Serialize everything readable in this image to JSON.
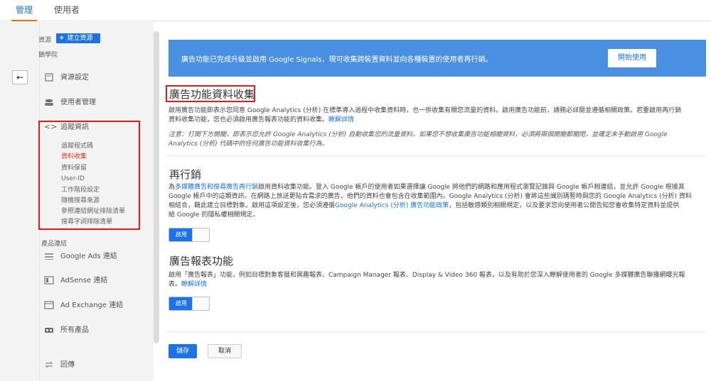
{
  "top_tabs": [
    {
      "label": "管理"
    },
    {
      "label": "使用者"
    }
  ],
  "sidebar": {
    "resource_label": "資源",
    "create_button": "建立資源",
    "plus_glyph": "+",
    "academy_label": "鵝學院",
    "items": [
      {
        "label": "資源設定",
        "icon": "document-icon"
      },
      {
        "label": "使用者管理",
        "icon": "users-icon"
      },
      {
        "label": "追蹤資訊",
        "icon": "code-icon"
      }
    ],
    "tracking_subitems": [
      {
        "label": "追蹤程式碼"
      },
      {
        "label": "資料收集",
        "active": true
      },
      {
        "label": "資料保留"
      },
      {
        "label": "User-ID"
      },
      {
        "label": "工作階段設定"
      },
      {
        "label": "隨機搜尋來源"
      },
      {
        "label": "參照連結網址排除清單"
      },
      {
        "label": "搜尋字詞排除清單"
      }
    ],
    "product_links_heading": "產品連結",
    "product_links": [
      {
        "label": "Google Ads 連結",
        "icon": "ads-icon"
      },
      {
        "label": "AdSense 連結",
        "icon": "adsense-icon"
      },
      {
        "label": "Ad Exchange 連結",
        "icon": "adexchange-icon"
      },
      {
        "label": "所有產品",
        "icon": "link-icon"
      }
    ],
    "postback_label": "回傳",
    "back_glyph": "←",
    "code_glyph": "<>"
  },
  "banner": {
    "text": "廣告功能已完成升級並啟用 Google Signals，現可收集跨裝置資料並向各種裝置的使用者再行銷。",
    "button": "開始使用"
  },
  "section_ad_features": {
    "title": "廣告功能資料收集",
    "para_1": "啟用廣告功能即表示您同意 Google Analytics (分析) 在標準導入過程中收集資料時，也一併收集有關您流量的資料。啟用廣告功能前，請務必詳閱並遵循相關政策。若要啟用再行銷",
    "para_2": "資料收集功能，您也必須啟用廣告報表功能的資料收集。",
    "learn_more": "瞭解詳情",
    "note_1": "注意：打開下方開關，即表示您允許 Google Analytics (分析) 自動收集您的流量資料。如果您不想收集廣告功能相關資料，必須將兩個開關都關閉，並確定未手動啟用 Google",
    "note_2": "Analytics (分析) 代碼中的任何廣告功能資料收集行為。"
  },
  "section_remarketing": {
    "title": "再行銷",
    "line_1_pre": "為",
    "line_1_link": "多媒體廣告和搜尋廣告再行銷",
    "line_1_post": "啟用資料收集功能。登入 Google 帳戶的使用者如果選擇讓 Google 將他們的網路和應用程式瀏覽記錄與 Google 帳戶相連結，並允許 Google 根據其",
    "line_2": "Google 帳戶中的這類資訊，在網路上放送更貼合需求的廣告，他們的資料也會包含在收集範圍內。Google Analytics (分析) 會將這些識別碼暫時與您的 Google Analytics (分析) 資料",
    "line_3_pre": "相結合，藉此建立目標對象。啟用這項設定後，您必須遵循",
    "line_3_link": "Google Analytics (分析) 廣告功能政策",
    "line_3_post": "，包括敏感類別相關規定，以及要求您向使用者公開告知您會收集特定資料並提供",
    "line_4": "給 Google 的隱私權相關規定。",
    "toggle_label": "啟用"
  },
  "section_reports": {
    "title": "廣告報表功能",
    "line_1": "啟用「廣告報表」功能，例如目標對象客層和興趣報表、Campaign Manager 報表、Display & Video 360 報表，以及有助於您深入瞭解使用者的 Google 多媒體廣告聯播網曝光報",
    "line_2_pre": "表。",
    "learn_more": "瞭解詳情",
    "toggle_label": "啟用"
  },
  "actions": {
    "save": "儲存",
    "cancel": "取消"
  }
}
